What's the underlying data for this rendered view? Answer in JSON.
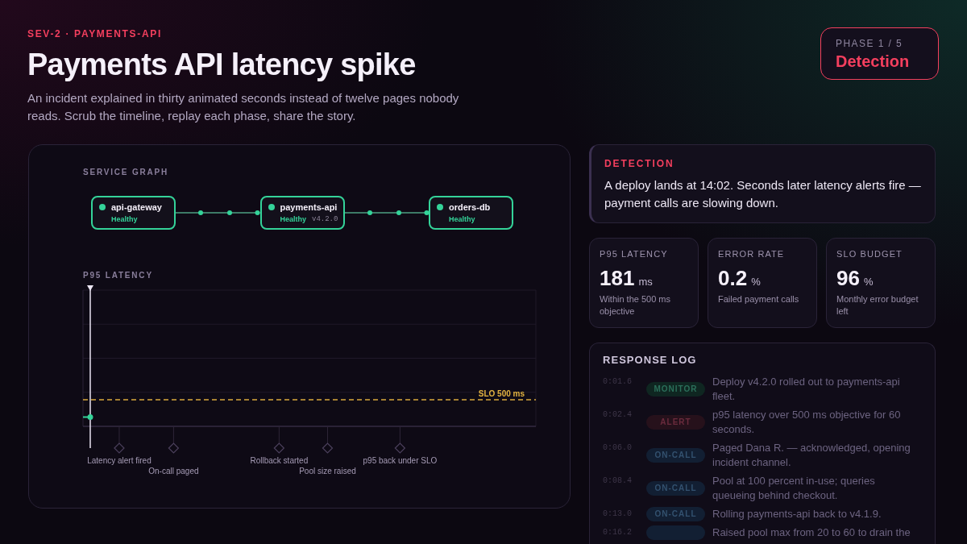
{
  "incident": {
    "severity": "SEV-2 · PAYMENTS-API",
    "title": "Payments API latency spike",
    "summary": "An incident explained in thirty animated seconds instead of twelve pages nobody reads. Scrub the timeline, replay each phase, share the story."
  },
  "phase": {
    "label": "PHASE 1 / 5",
    "name": "Detection"
  },
  "service_graph": {
    "title": "SERVICE GRAPH",
    "services": [
      {
        "name": "api-gateway",
        "status": "Healthy"
      },
      {
        "name": "payments-api",
        "status": "Healthy",
        "version": "v4.2.0"
      },
      {
        "name": "orders-db",
        "status": "Healthy"
      }
    ]
  },
  "latency_panel": {
    "title": "P95 LATENCY",
    "slo_label": "SLO 500 ms",
    "playhead": {
      "level": 0.016
    },
    "events": [
      {
        "label": "Latency alert fired"
      },
      {
        "label": "On-call paged"
      },
      {
        "label": "Rollback started"
      },
      {
        "label": "Pool size raised"
      },
      {
        "label": "p95 back under SLO"
      }
    ]
  },
  "story": {
    "title": "DETECTION",
    "text": "A deploy lands at 14:02. Seconds later latency alerts fire — payment calls are slowing down."
  },
  "metrics": [
    {
      "label": "P95 LATENCY",
      "value": "181",
      "unit": "ms",
      "note": "Within the 500 ms objective"
    },
    {
      "label": "ERROR RATE",
      "value": "0.2",
      "unit": "%",
      "note": "Failed payment calls"
    },
    {
      "label": "SLO BUDGET",
      "value": "96",
      "unit": "%",
      "note": "Monthly error budget left"
    }
  ],
  "response_log": {
    "title": "RESPONSE LOG",
    "entries": [
      {
        "time": "0:01.6",
        "tag": "MONITOR",
        "kind": "monitor",
        "active": false,
        "text": "Deploy v4.2.0 rolled out to payments-api fleet."
      },
      {
        "time": "0:02.4",
        "tag": "ALERT",
        "kind": "alert",
        "active": false,
        "text": "p95 latency over 500 ms objective for 60 seconds."
      },
      {
        "time": "0:06.0",
        "tag": "ON-CALL",
        "kind": "oncall",
        "active": false,
        "text": "Paged Dana R. — acknowledged, opening incident channel."
      },
      {
        "time": "0:08.4",
        "tag": "ON-CALL",
        "kind": "oncall",
        "active": false,
        "text": "Pool at 100 percent in-use; queries queueing behind checkout."
      },
      {
        "time": "0:13.0",
        "tag": "ON-CALL",
        "kind": "oncall",
        "active": false,
        "text": "Rolling payments-api back to v4.1.9."
      },
      {
        "time": "0:16.2",
        "kind": "oncall",
        "active": false,
        "text": "Raised pool max from 20 to 60 to drain the"
      }
    ]
  }
}
